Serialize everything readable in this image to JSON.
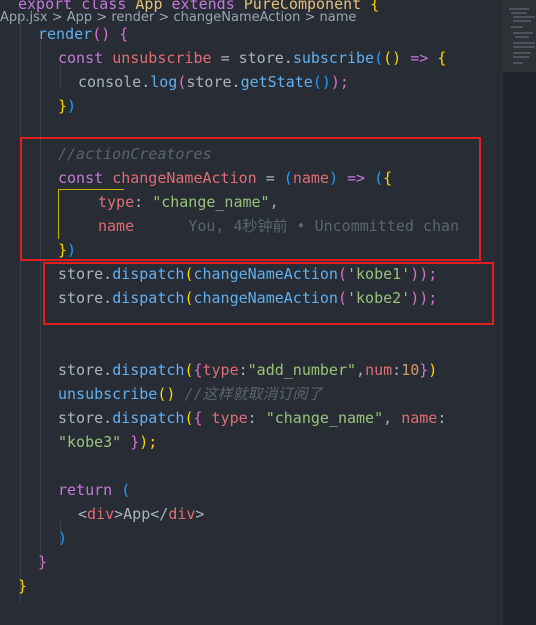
{
  "breadcrumb": {
    "file": "App.jsx",
    "sep1": " > ",
    "cls": "App",
    "sep2": " > ",
    "method": "render",
    "sep3": " > ",
    "fn": "changeNameAction",
    "sep4": " > ",
    "prop": "name"
  },
  "code": {
    "l0": {
      "kw": "export",
      "kw2": "class",
      "cls": "App",
      "kw3": "extends",
      "cls2": "PureComponent",
      "br": "{"
    },
    "l1": {
      "fn": "render",
      "br": "()",
      "br2": "{"
    },
    "l2": {
      "kw": "const",
      "var": "unsubscribe",
      "op": "=",
      "obj": "store",
      "dot": ".",
      "fn": "subscribe",
      "p1": "(",
      "p2": "()",
      "arrow": "=>",
      "br": "{"
    },
    "l3": {
      "obj": "console",
      "dot": ".",
      "fn": "log",
      "p1": "(",
      "obj2": "store",
      "dot2": ".",
      "fn2": "getState",
      "p2": "()",
      "p3": ");"
    },
    "l4": {
      "br": "}",
      "p": ")"
    },
    "l6": {
      "comment": "//actionCreatores"
    },
    "l7": {
      "kw": "const",
      "var": "changeNameAction",
      "op": "=",
      "p1": "(",
      "param": "name",
      "p2": ")",
      "arrow": "=>",
      "p3": "(",
      "br": "{"
    },
    "l8": {
      "prop": "type",
      "colon": ":",
      "str": "\"change_name\"",
      "comma": ","
    },
    "l9": {
      "prop": "name",
      "blame": "You, 4秒钟前 • Uncommitted chan"
    },
    "l10": {
      "br": "}",
      "p": ")"
    },
    "l11": {
      "obj": "store",
      "dot": ".",
      "fn": "dispatch",
      "p1": "(",
      "fn2": "changeNameAction",
      "p2": "(",
      "str": "'kobe1'",
      "p3": "));"
    },
    "l12": {
      "obj": "store",
      "dot": ".",
      "fn": "dispatch",
      "p1": "(",
      "fn2": "changeNameAction",
      "p2": "(",
      "str": "'kobe2'",
      "p3": "));"
    },
    "l15": {
      "obj": "store",
      "dot": ".",
      "fn": "dispatch",
      "p1": "(",
      "br": "{",
      "prop": "type",
      "colon": ":",
      "str": "\"add_number\"",
      "comma": ",",
      "prop2": "num",
      "colon2": ":",
      "num": "10",
      "br2": "}",
      "p2": ")"
    },
    "l16": {
      "fn": "unsubscribe",
      "p": "()",
      "comment": "//这样就取消订阅了"
    },
    "l17": {
      "obj": "store",
      "dot": ".",
      "fn": "dispatch",
      "p1": "(",
      "br": "{",
      "prop": "type",
      "colon": ":",
      "str": "\"change_name\"",
      "comma": ",",
      "prop2": "name",
      "colon2": ":"
    },
    "l18": {
      "str": "\"kobe3\"",
      "br": "}",
      "p": ");"
    },
    "l20": {
      "kw": "return",
      "p": "("
    },
    "l21": {
      "t1": "<",
      "tag": "div",
      "t2": ">",
      "text": "App",
      "t3": "</",
      "tag2": "div",
      "t4": ">"
    },
    "l22": {
      "p": ")"
    },
    "l23": {
      "br": "}"
    },
    "l24": {
      "br": "}"
    }
  },
  "colors": {
    "background": "#282c34",
    "keyword": "#c678dd",
    "function": "#61afef",
    "string": "#98c379",
    "variable": "#e06c75",
    "comment": "#5c6370",
    "highlight_box": "#e02020"
  }
}
